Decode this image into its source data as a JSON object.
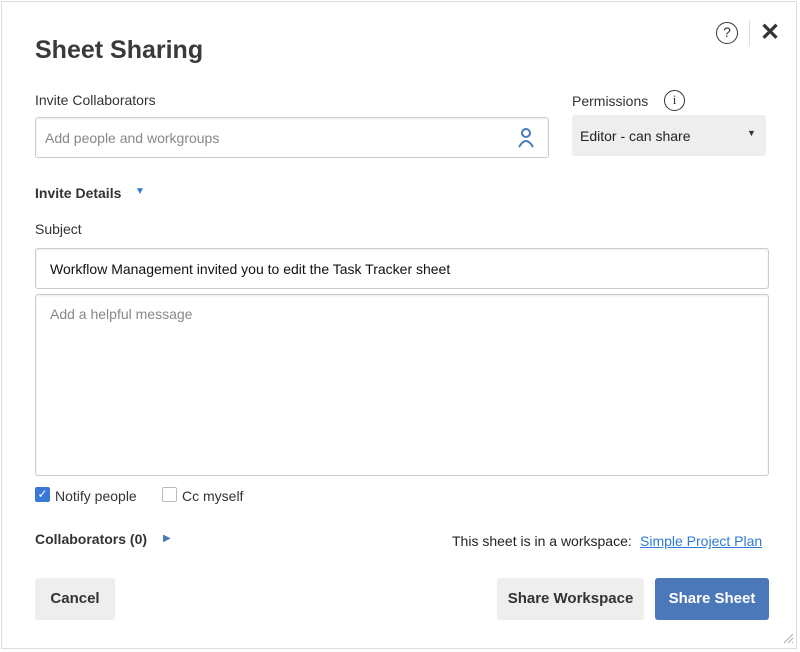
{
  "title": "Sheet Sharing",
  "help_icon": "?",
  "close_icon": "✕",
  "invite": {
    "label": "Invite Collaborators",
    "placeholder": "Add people and workgroups"
  },
  "permissions": {
    "label": "Permissions",
    "info_icon": "i",
    "selected": "Editor - can share"
  },
  "invite_details": {
    "label": "Invite Details",
    "subject_label": "Subject",
    "subject_value": "Workflow Management invited you to edit the Task Tracker sheet",
    "message_placeholder": "Add a helpful message"
  },
  "options": {
    "notify": {
      "label": "Notify people",
      "checked": true
    },
    "cc": {
      "label": "Cc myself",
      "checked": false
    }
  },
  "collaborators": {
    "label": "Collaborators (0)"
  },
  "workspace": {
    "text": "This sheet is in a workspace:",
    "link": "Simple Project Plan"
  },
  "buttons": {
    "cancel": "Cancel",
    "share_workspace": "Share Workspace",
    "share_sheet": "Share Sheet"
  },
  "colors": {
    "accent": "#4a78b8",
    "link": "#2d7bd4"
  }
}
